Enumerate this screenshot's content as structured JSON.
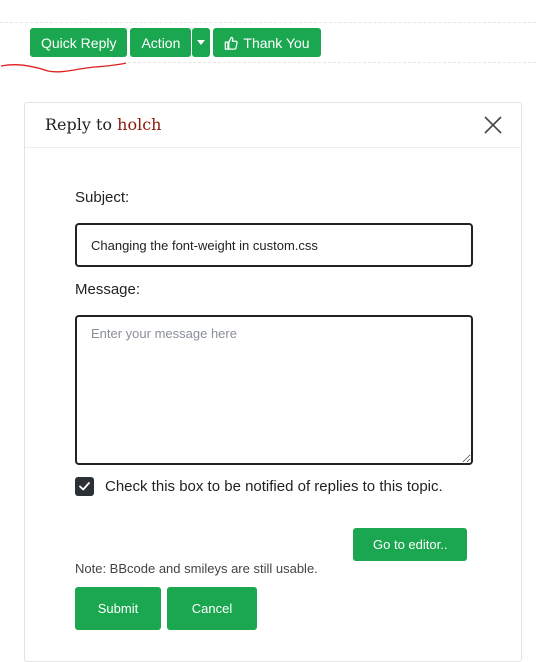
{
  "toolbar": {
    "quick_reply": "Quick Reply",
    "action": "Action",
    "thank_you": "Thank You"
  },
  "panel": {
    "title_prefix": "Reply to",
    "title_user": "holch",
    "subject_label": "Subject:",
    "subject_value": "Changing the font-weight in custom.css",
    "message_label": "Message:",
    "message_placeholder": "Enter your message here",
    "notify_label": "Check this box to be notified of replies to this topic.",
    "notify_checked": true,
    "go_editor": "Go to editor..",
    "note": "Note: BBcode and smileys are still usable.",
    "submit": "Submit",
    "cancel": "Cancel"
  },
  "colors": {
    "button_green": "#1aa750",
    "username": "#8b1a0c",
    "annotation_red": "#e02020"
  },
  "icons": [
    "thumbs-up-icon",
    "caret-down-icon",
    "close-icon",
    "checkmark-icon"
  ]
}
